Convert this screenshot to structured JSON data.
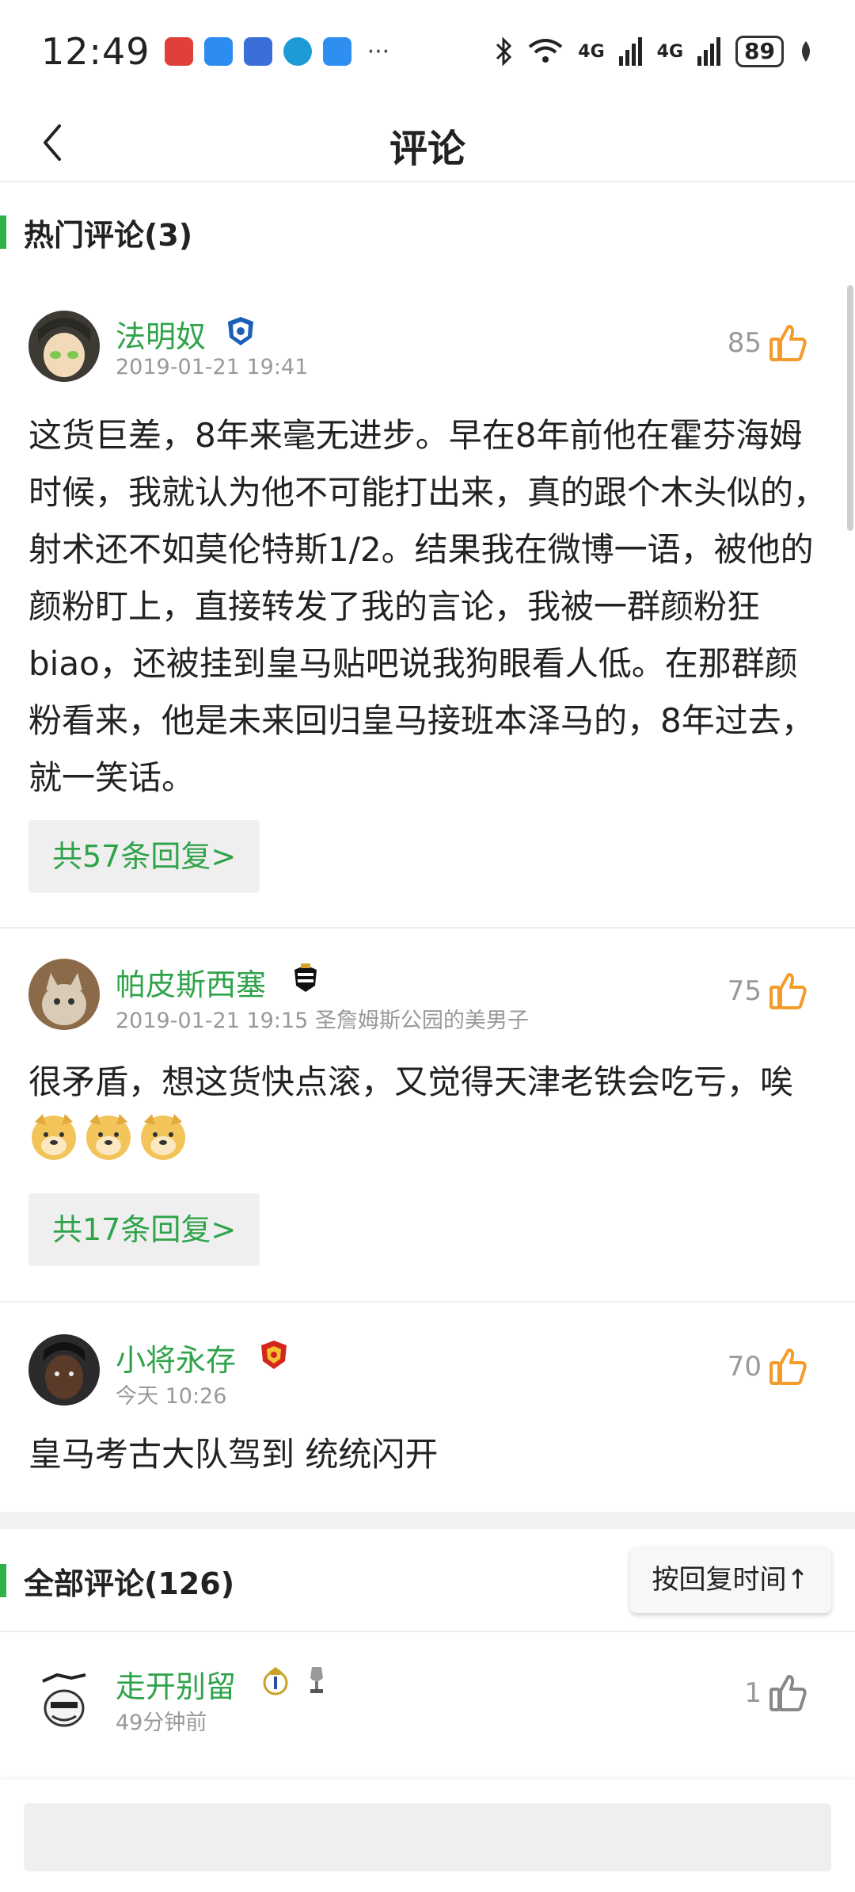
{
  "status_bar": {
    "time": "12:49",
    "network_1": "4G",
    "network_2": "4G",
    "battery": "89"
  },
  "header": {
    "title": "评论",
    "back_icon": "chevron-left-icon"
  },
  "hot_section": {
    "title": "热门评论(3)"
  },
  "hot_comments": [
    {
      "username": "法明奴",
      "meta": "2019-01-21 19:41",
      "likes": "85",
      "text": "这货巨差，8年来毫无进步。早在8年前他在霍芬海姆时候，我就认为他不可能打出来，真的跟个木头似的，射术还不如莫伦特斯1/2。结果我在微博一语，被他的颜粉盯上，直接转发了我的言论，我被一群颜粉狂biao，还被挂到皇马贴吧说我狗眼看人低。在那群颜粉看来，他是未来回归皇马接班本泽马的，8年过去，就一笑话。",
      "replies": "共57条回复>"
    },
    {
      "username": "帕皮斯西塞",
      "meta": "2019-01-21 19:15 圣詹姆斯公园的美男子",
      "likes": "75",
      "text": "很矛盾，想这货快点滚，又觉得天津老铁会吃亏，唉",
      "replies": "共17条回复>"
    },
    {
      "username": "小将永存",
      "meta": "今天 10:26",
      "likes": "70",
      "text": "皇马考古大队驾到 统统闪开"
    }
  ],
  "all_section": {
    "title": "全部评论(126)",
    "sort_label": "按回复时间↑"
  },
  "all_comments": [
    {
      "username": "走开别留",
      "meta": "49分钟前",
      "likes": "1"
    }
  ],
  "colors": {
    "accent_green": "#2fa34a",
    "like_orange": "#f39c2b"
  }
}
